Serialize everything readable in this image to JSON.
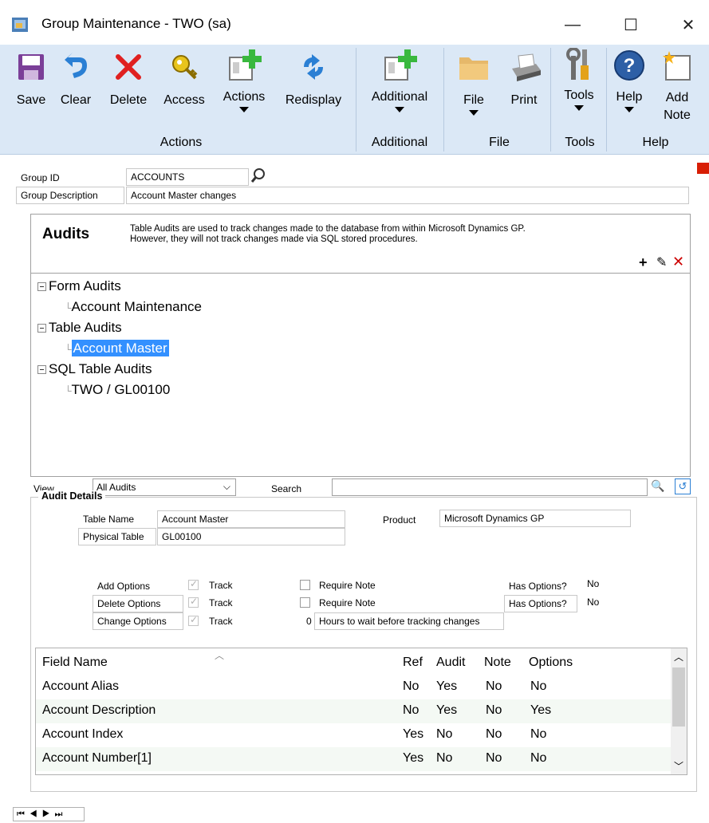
{
  "window": {
    "title": "Group Maintenance  -  TWO (sa)",
    "minimize": "—",
    "maximize": "☐",
    "close": "✕"
  },
  "ribbon": {
    "buttons": [
      {
        "label": "Save"
      },
      {
        "label": "Clear"
      },
      {
        "label": "Delete"
      },
      {
        "label": "Access"
      },
      {
        "label": "Actions"
      },
      {
        "label": "Redisplay"
      },
      {
        "label": "Additional"
      },
      {
        "label": "File"
      },
      {
        "label": "Print"
      },
      {
        "label": "Tools"
      },
      {
        "label": "Help"
      },
      {
        "label": "Add\nNote"
      }
    ],
    "groups": {
      "actions": "Actions",
      "additional": "Additional",
      "file": "File",
      "tools": "Tools",
      "help": "Help"
    }
  },
  "header": {
    "group_id_label": "Group ID",
    "group_id_value": "ACCOUNTS",
    "group_desc_label": "Group Description",
    "group_desc_value": "Account Master changes"
  },
  "audits": {
    "title": "Audits",
    "description_1": "Table Audits are used to track changes made to the database from within Microsoft Dynamics GP.",
    "description_2": "However, they will not track changes made via SQL stored procedures.",
    "tree": {
      "form_audits": "Form Audits",
      "account_maintenance": "Account Maintenance",
      "table_audits": "Table Audits",
      "account_master": "Account Master",
      "sql_table_audits": "SQL Table Audits",
      "two_gl00100": "TWO / GL00100"
    },
    "view_label": "View",
    "view_value": "All Audits",
    "search_label": "Search"
  },
  "details": {
    "title": "Audit Details",
    "table_name_label": "Table Name",
    "table_name_value": "Account Master",
    "physical_table_label": "Physical Table",
    "physical_table_value": "GL00100",
    "product_label": "Product",
    "product_value": "Microsoft Dynamics GP",
    "add_options": "Add Options",
    "delete_options": "Delete Options",
    "change_options": "Change Options",
    "track": "Track",
    "require_note": "Require Note",
    "has_options": "Has Options?",
    "has_options_add": "No",
    "has_options_delete": "No",
    "hours_value": "0",
    "hours_label": "Hours to wait before tracking changes"
  },
  "grid": {
    "headers": {
      "field": "Field Name",
      "ref": "Ref",
      "audit": "Audit",
      "note": "Note",
      "options": "Options"
    },
    "rows": [
      {
        "field": "Account Alias",
        "ref": "No",
        "audit": "Yes",
        "note": "No",
        "options": "No"
      },
      {
        "field": "Account Description",
        "ref": "No",
        "audit": "Yes",
        "note": "No",
        "options": "Yes"
      },
      {
        "field": "Account Index",
        "ref": "Yes",
        "audit": "No",
        "note": "No",
        "options": "No"
      },
      {
        "field": "Account Number[1]",
        "ref": "Yes",
        "audit": "No",
        "note": "No",
        "options": "No"
      }
    ]
  },
  "colors": {
    "ribbon": "#dbe8f6",
    "selection": "#3390ff",
    "alt_row": "#f4f9f4"
  }
}
